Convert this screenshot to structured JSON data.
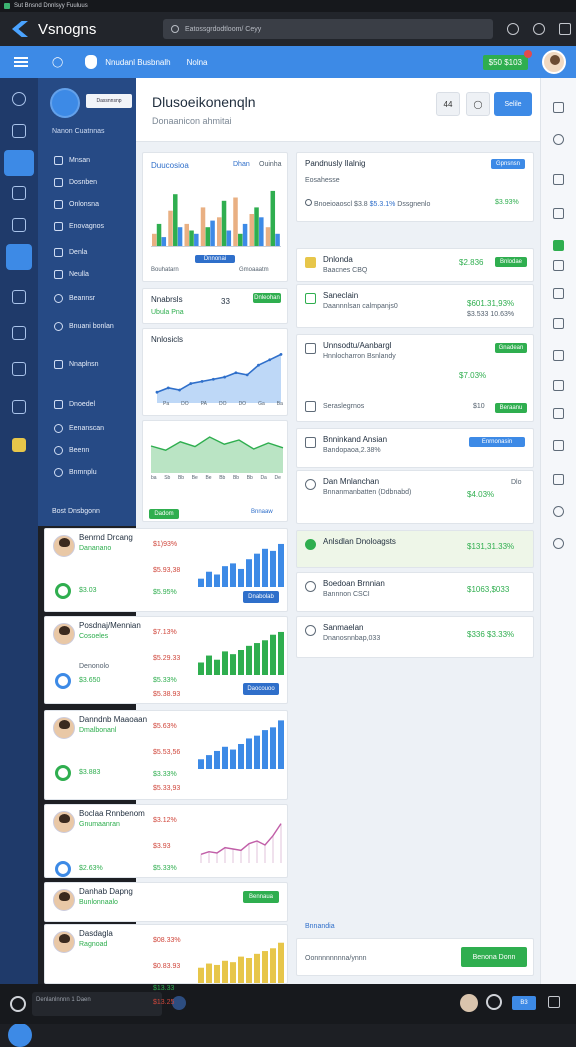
{
  "window": {
    "title": "Sut Bnsnd Dnnlsyy Fuuluus"
  },
  "topbar": {
    "app_title": "Vsnogns",
    "search_text": "Eatossgrdodtloom/ Ceyy"
  },
  "header": {
    "back_label": "◯",
    "org_name": "Nnudanl Busbnalh",
    "org_sub": "Nolna",
    "badge_label": "$50 $103"
  },
  "nav": {
    "pill_label": "Dassnnsnp",
    "heading": "Nanon Cuatnnas",
    "items": [
      {
        "label": "Mnsan"
      },
      {
        "label": "Dosnben"
      },
      {
        "label": "Onlonsna"
      },
      {
        "label": "Enovagnos"
      },
      {
        "label": "Denla"
      },
      {
        "label": "Neulla"
      },
      {
        "label": "Beannsr"
      },
      {
        "label": "Bnuani bonlan"
      },
      {
        "label": "Nnaplnsn"
      },
      {
        "label": "Dnoedel"
      },
      {
        "label": "Eenanscan"
      },
      {
        "label": "Beenn"
      },
      {
        "label": "Bnmnplu"
      }
    ],
    "footer": "Bost Dnsbgonn"
  },
  "page": {
    "title": "Dlusoeikonenqln",
    "subtitle": "Donaanicon ahmitai",
    "btn1": "44",
    "btn2": "◯",
    "primary": "Selile"
  },
  "chart1": {
    "title": "Duucosioa",
    "tag1": "Dhan",
    "tag2": "Ouinha",
    "foot1": "Bouhatarn",
    "foot_btn": "Dnnonai",
    "foot2": "Gmoaaatm"
  },
  "chart1_data": {
    "type": "bar",
    "series": [
      {
        "name": "",
        "values": [
          20,
          55,
          35,
          60,
          45,
          75,
          50,
          30
        ]
      },
      {
        "name": "",
        "values": [
          35,
          80,
          25,
          30,
          70,
          20,
          60,
          85
        ]
      },
      {
        "name": "",
        "values": [
          15,
          30,
          20,
          40,
          25,
          35,
          45,
          20
        ]
      }
    ],
    "xlabel": "",
    "ylabel": ""
  },
  "summary": {
    "title": "Nnabrsls",
    "value": "33",
    "btn": "Dnleohan",
    "sub": "Ubula Pna"
  },
  "chart2": {
    "title": "Nnlosicls",
    "ticks": [
      "Pa",
      "DO",
      "PA",
      "DO",
      "DO",
      "Ga",
      "Ba"
    ],
    "values": [
      10,
      14,
      12,
      18,
      20,
      22,
      24,
      28,
      26,
      35,
      40,
      45
    ]
  },
  "chart3": {
    "ticks": [
      "ba",
      "Sb",
      "Bb",
      "Be",
      "Be",
      "Bb",
      "Bb",
      "Bb",
      "Da",
      "De"
    ],
    "values": [
      45,
      38,
      52,
      44,
      60,
      48,
      55,
      40,
      50,
      42
    ],
    "left_btn": "Dadom",
    "right_label": "Bnnaaw"
  },
  "profiles": [
    {
      "name": "Benrnd Drcang",
      "sub": "Dananano",
      "pct1": "$1)93%",
      "pct2": "$5.93,38",
      "pct3": "$5.95%",
      "value": "$3.03",
      "btn": "Dnabolab",
      "bars": [
        12,
        22,
        18,
        30,
        34,
        26,
        40,
        48,
        55,
        52,
        62
      ]
    },
    {
      "name": "Posdnaj/Mennian",
      "sub": "Cosoeles",
      "pct1": "$7.13%",
      "pct2": "$5.29.33",
      "sub2": "Denonolo",
      "val2": "$3.650",
      "pct3": "$5.33%",
      "pct4": "$5.38.93",
      "btn": "Daocouoo",
      "bars": [
        18,
        28,
        22,
        34,
        30,
        36,
        42,
        46,
        50,
        58,
        62
      ]
    },
    {
      "name": "Danndnb Maaoaan",
      "sub": "Dmalbonanl",
      "pct1": "$5.63%",
      "pct2": "$5.53,56",
      "value": "$3.883",
      "pct3": "$3.33%",
      "pct4": "$5.33,93",
      "bars": [
        14,
        20,
        26,
        32,
        28,
        36,
        44,
        48,
        56,
        60,
        70
      ]
    },
    {
      "name": "Boclaa Rnnbenom",
      "sub": "Gnumaanran",
      "pct1": "$3.12%",
      "pct2": "$3.93",
      "val2": "$2.63%",
      "pct3": "$5.33%",
      "bars": [
        10,
        14,
        12,
        20,
        18,
        16,
        26,
        30,
        24,
        38,
        56
      ]
    },
    {
      "name": "Danhab Dapng",
      "sub": "Bunlonnaalo",
      "btn": "Bennaua",
      "bars": []
    },
    {
      "name": "Dasdagla",
      "sub": "Ragnoad",
      "pct1": "$08.33%",
      "pct2": "$0.83.93",
      "pct3": "$13.33",
      "pct4": "$13.25",
      "bars": [
        22,
        28,
        26,
        32,
        30,
        38,
        36,
        42,
        46,
        50,
        58
      ]
    }
  ],
  "stats_top": {
    "title": "Pandnusly Ilalnig",
    "sub": "Eosahesse",
    "btn": "Gpnsnsn",
    "line": "Bnoeioaoscl",
    "v1": "$3.8",
    "v2": "$5.3.1%",
    "v3": "Dssgnenlo",
    "v4": "$3.93%"
  },
  "list": [
    {
      "title": "Dnlonda",
      "sub": "Baacnes CBQ",
      "value": "$2.836",
      "btn": "Bnlodae",
      "icon": "yellow"
    },
    {
      "title": "Saneclain",
      "sub": "Daannnlsan calmpanjs0",
      "value": "$601.31,93%",
      "value2": "$3.533 10.63%",
      "icon": "green-box"
    },
    {
      "title": "Unnsodtu/Aanbargl",
      "sub": "Hnnlocharron Bsnlandy",
      "value": "$7.03%",
      "btn": "Gnadean",
      "sub2": "Seraslegrnos",
      "value2": "$10",
      "btn2": "Beraanu",
      "icon": "grid"
    },
    {
      "title": "Bnninkand Ansian",
      "sub": "Bandopaoa,2.38%",
      "btn": "Enrnonasin",
      "icon": "grid"
    },
    {
      "title": "Dan Mnlanchan",
      "sub": "Bnnanmanbatten (Ddbnabd)",
      "value": "$4.03%",
      "tag": "Dlo",
      "icon": "circle"
    },
    {
      "title": "Anlsdlan Dnoloagsts",
      "value": "$131,31.33%",
      "icon": "green-circle"
    },
    {
      "title": "Boedoan Brnnian",
      "sub": "Bannnon CSCI",
      "value": "$1063,$033",
      "icon": "circle"
    },
    {
      "title": "Sanmaelan",
      "sub": "Dnanosnnbap,033",
      "value": "$336 $3.33%",
      "icon": "circle"
    }
  ],
  "bottom_card": {
    "title": "Bnnandia",
    "line": "Oonnnnnnnna/ynnn",
    "btn": "Benona Donn"
  },
  "bottombar": {
    "field": "Denlanlnnnn 1 Daen",
    "badge": "B3"
  },
  "colors": {
    "accent": "#3d8ae6",
    "nav": "#264a85",
    "rail": "#1f3a6a",
    "green": "#2fae4f",
    "red": "#d0473c"
  }
}
